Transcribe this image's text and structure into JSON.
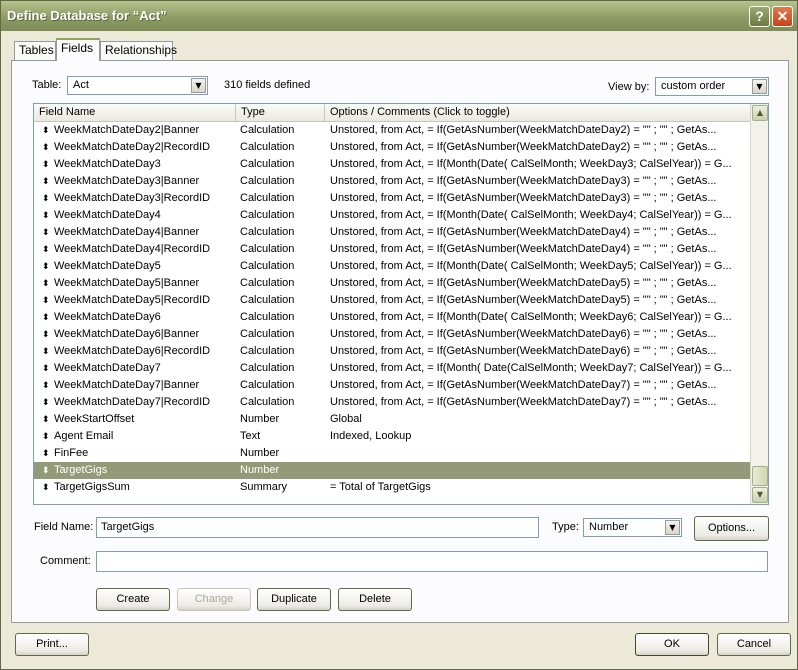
{
  "window": {
    "title": "Define Database for “Act”"
  },
  "tabs": [
    {
      "label": "Tables"
    },
    {
      "label": "Fields"
    },
    {
      "label": "Relationships"
    }
  ],
  "table_select": {
    "label": "Table:",
    "value": "Act"
  },
  "field_count": "310 fields defined",
  "view_by": {
    "label": "View by:",
    "value": "custom order"
  },
  "columns": {
    "name": "Field Name",
    "type": "Type",
    "options": "Options / Comments   (Click to toggle)"
  },
  "rows": [
    {
      "name": "WeekMatchDateDay2|Banner",
      "type": "Calculation",
      "options": "Unstored, from Act, = If(GetAsNumber(WeekMatchDateDay2) = \"\" ;      \"\" ;     GetAs..."
    },
    {
      "name": "WeekMatchDateDay2|RecordID",
      "type": "Calculation",
      "options": "Unstored, from Act, = If(GetAsNumber(WeekMatchDateDay2) = \"\" ;      \"\" ;     GetAs..."
    },
    {
      "name": "WeekMatchDateDay3",
      "type": "Calculation",
      "options": "Unstored, from Act, = If(Month(Date(     CalSelMonth; WeekDay3; CalSelYear)) = G..."
    },
    {
      "name": "WeekMatchDateDay3|Banner",
      "type": "Calculation",
      "options": "Unstored, from Act, = If(GetAsNumber(WeekMatchDateDay3) = \"\" ;      \"\" ;     GetAs..."
    },
    {
      "name": "WeekMatchDateDay3|RecordID",
      "type": "Calculation",
      "options": "Unstored, from Act, = If(GetAsNumber(WeekMatchDateDay3) = \"\" ;      \"\" ;     GetAs..."
    },
    {
      "name": "WeekMatchDateDay4",
      "type": "Calculation",
      "options": "Unstored, from Act, = If(Month(Date(     CalSelMonth; WeekDay4; CalSelYear)) = G..."
    },
    {
      "name": "WeekMatchDateDay4|Banner",
      "type": "Calculation",
      "options": "Unstored, from Act, = If(GetAsNumber(WeekMatchDateDay4) = \"\" ;      \"\" ;     GetAs..."
    },
    {
      "name": "WeekMatchDateDay4|RecordID",
      "type": "Calculation",
      "options": "Unstored, from Act, = If(GetAsNumber(WeekMatchDateDay4) = \"\" ;      \"\" ;     GetAs..."
    },
    {
      "name": "WeekMatchDateDay5",
      "type": "Calculation",
      "options": "Unstored, from Act, = If(Month(Date(     CalSelMonth; WeekDay5; CalSelYear)) = G..."
    },
    {
      "name": "WeekMatchDateDay5|Banner",
      "type": "Calculation",
      "options": "Unstored, from Act, = If(GetAsNumber(WeekMatchDateDay5) = \"\" ;      \"\" ;     GetAs..."
    },
    {
      "name": "WeekMatchDateDay5|RecordID",
      "type": "Calculation",
      "options": "Unstored, from Act, = If(GetAsNumber(WeekMatchDateDay5) = \"\" ;      \"\" ;     GetAs..."
    },
    {
      "name": "WeekMatchDateDay6",
      "type": "Calculation",
      "options": "Unstored, from Act, = If(Month(Date(     CalSelMonth; WeekDay6; CalSelYear)) = G..."
    },
    {
      "name": "WeekMatchDateDay6|Banner",
      "type": "Calculation",
      "options": "Unstored, from Act, = If(GetAsNumber(WeekMatchDateDay6) = \"\" ;      \"\" ;     GetAs..."
    },
    {
      "name": "WeekMatchDateDay6|RecordID",
      "type": "Calculation",
      "options": "Unstored, from Act, = If(GetAsNumber(WeekMatchDateDay6) = \"\" ;      \"\" ;     GetAs..."
    },
    {
      "name": "WeekMatchDateDay7",
      "type": "Calculation",
      "options": "Unstored, from Act, = If(Month(     Date(CalSelMonth; WeekDay7; CalSelYear)) = G..."
    },
    {
      "name": "WeekMatchDateDay7|Banner",
      "type": "Calculation",
      "options": "Unstored, from Act, = If(GetAsNumber(WeekMatchDateDay7) = \"\" ;      \"\" ;     GetAs..."
    },
    {
      "name": "WeekMatchDateDay7|RecordID",
      "type": "Calculation",
      "options": "Unstored, from Act, = If(GetAsNumber(WeekMatchDateDay7) = \"\" ;      \"\" ;     GetAs..."
    },
    {
      "name": "WeekStartOffset",
      "type": "Number",
      "options": "Global"
    },
    {
      "name": "Agent Email",
      "type": "Text",
      "options": "Indexed, Lookup"
    },
    {
      "name": "FinFee",
      "type": "Number",
      "options": ""
    },
    {
      "name": "TargetGigs",
      "type": "Number",
      "options": "",
      "selected": true
    },
    {
      "name": "TargetGigsSum",
      "type": "Summary",
      "options": "= Total of TargetGigs"
    }
  ],
  "field_name": {
    "label": "Field Name:",
    "value": "TargetGigs"
  },
  "type_select": {
    "label": "Type:",
    "value": "Number"
  },
  "options_button": "Options...",
  "comment": {
    "label": "Comment:",
    "value": ""
  },
  "actions": {
    "create": "Create",
    "change": "Change",
    "duplicate": "Duplicate",
    "delete": "Delete"
  },
  "footer": {
    "print": "Print...",
    "ok": "OK",
    "cancel": "Cancel"
  },
  "colors": {
    "titlebar": "#8e9b63",
    "selected_row": "#949a78",
    "tab_accent": "#8fa45a"
  },
  "icons": {
    "help": "question-mark-icon",
    "close": "close-x-icon",
    "row_handle": "updown-arrow-icon"
  }
}
